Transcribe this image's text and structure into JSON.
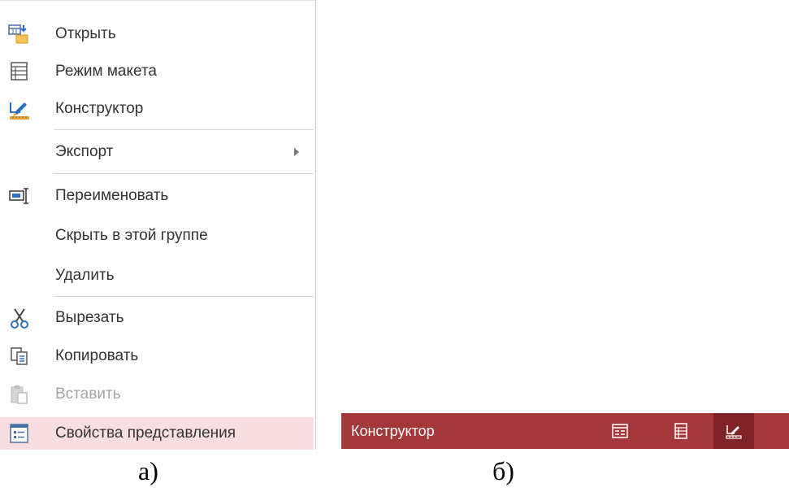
{
  "menu": {
    "items": [
      {
        "label": "Открыть",
        "icon": "open-datasheet-icon"
      },
      {
        "label": "Режим макета",
        "icon": "layout-view-icon"
      },
      {
        "label": "Конструктор",
        "icon": "design-view-icon"
      },
      {
        "label": "Экспорт",
        "icon": "submenu-arrow-icon"
      },
      {
        "label": "Переименовать",
        "icon": "rename-icon"
      },
      {
        "label": "Скрыть в этой группе"
      },
      {
        "label": "Удалить"
      },
      {
        "label": "Вырезать",
        "icon": "scissors-icon"
      },
      {
        "label": "Копировать",
        "icon": "copy-icon"
      },
      {
        "label": "Вставить",
        "icon": "paste-icon",
        "disabled": true
      },
      {
        "label": "Свойства представления",
        "icon": "properties-icon",
        "highlighted": true
      }
    ]
  },
  "statusbar": {
    "label": "Конструктор",
    "views": [
      {
        "icon": "form-view-icon",
        "active": false
      },
      {
        "icon": "layout-view-icon",
        "active": false
      },
      {
        "icon": "design-view-icon",
        "active": true
      }
    ],
    "color": "#a4373a",
    "active_color": "#7e2427"
  },
  "captions": {
    "a": "а)",
    "b": "б)"
  },
  "colors": {
    "highlight": "#f8dede",
    "disabled_text": "#a6a6a6",
    "text": "#333333"
  }
}
